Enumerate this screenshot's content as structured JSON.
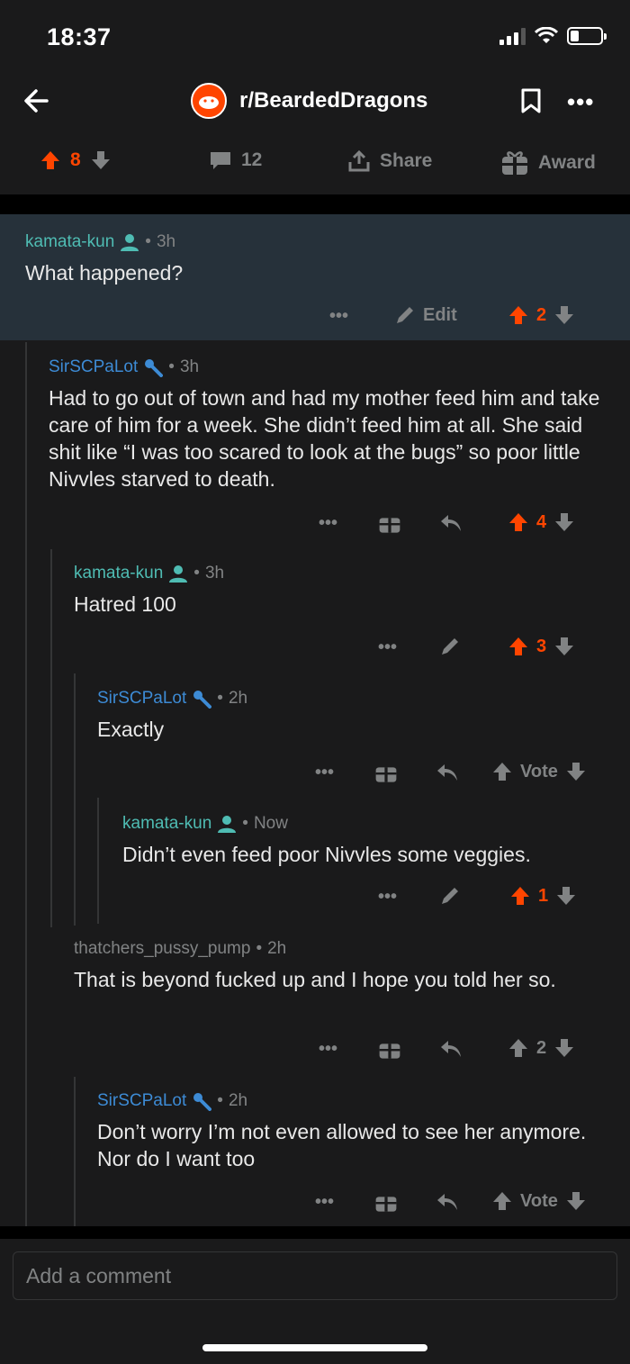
{
  "status": {
    "time": "18:37"
  },
  "header": {
    "subreddit": "r/BeardedDragons"
  },
  "post_actions": {
    "upvotes": "8",
    "comments": "12",
    "share_label": "Share",
    "award_label": "Award"
  },
  "comments": [
    {
      "user": "kamata-kun",
      "age": "3h",
      "body": "What happened?",
      "edit_label": "Edit",
      "score": "2"
    },
    {
      "user": "SirSCPaLot",
      "age": "3h",
      "body": "Had to go out of town and had my mother feed him and take care of him for a week. She didn’t feed him at all. She said shit like “I was too scared to look at the bugs” so poor little Nivvles starved to death.",
      "score": "4"
    },
    {
      "user": "kamata-kun",
      "age": "3h",
      "body": "Hatred 100",
      "score": "3"
    },
    {
      "user": "SirSCPaLot",
      "age": "2h",
      "body": "Exactly",
      "score": "Vote"
    },
    {
      "user": "kamata-kun",
      "age": "Now",
      "body": "Didn’t even feed poor Nivvles some veggies.",
      "score": "1"
    },
    {
      "user": "thatchers_pussy_pump",
      "age": "2h",
      "body": "That is beyond fucked up and I hope you told her so.",
      "score": "2"
    },
    {
      "user": "SirSCPaLot",
      "age": "2h",
      "body": "Don’t worry I’m not even allowed to see her anymore. Nor do I want too",
      "score": "Vote"
    }
  ],
  "composer": {
    "placeholder": "Add a comment"
  },
  "colors": {
    "accent": "#ff4500",
    "mod_blue": "#3d8bd5",
    "op_teal": "#4fbcb3"
  }
}
